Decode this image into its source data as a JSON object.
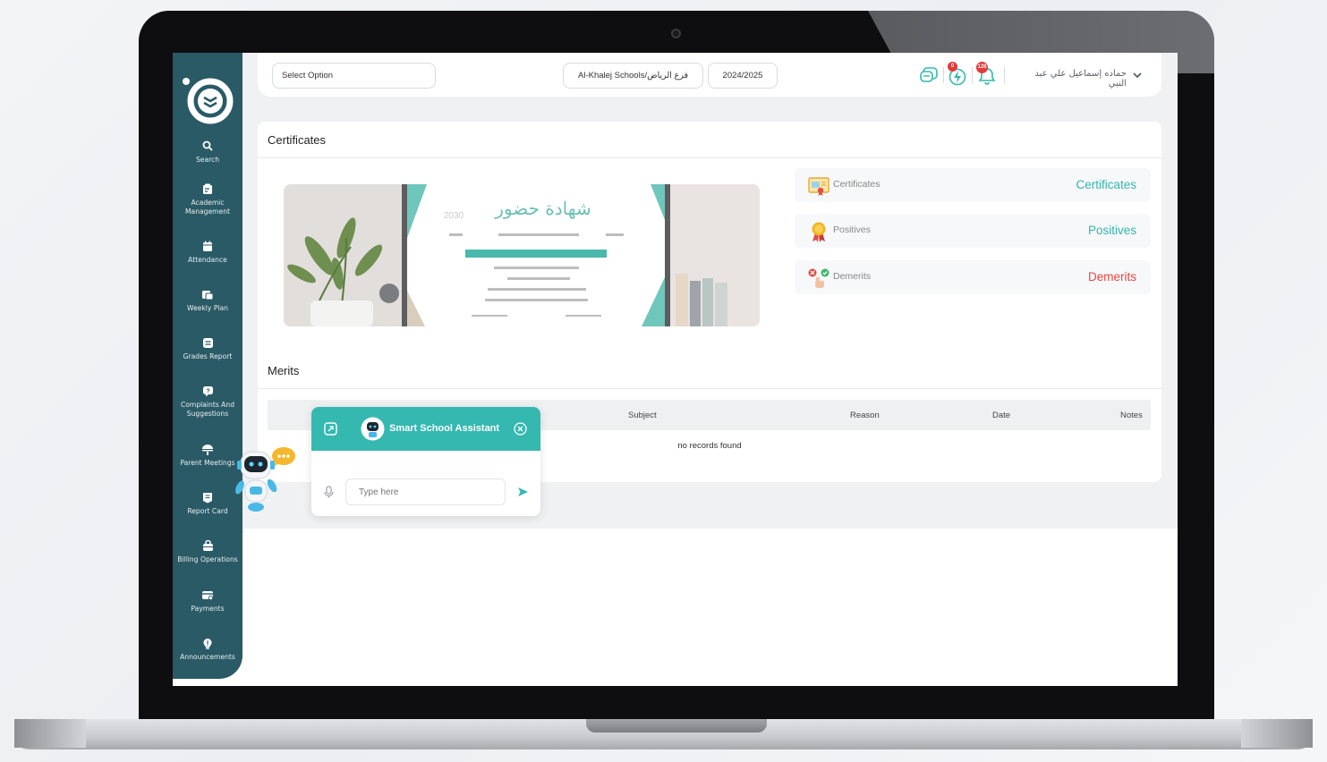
{
  "header": {
    "select_placeholder": "Select Option",
    "school": "Al-Khalej Schools/فرع الرياض",
    "year": "2024/2025",
    "lightning_badge": "0",
    "bell_badge": "128",
    "user_name": "حماده إسماعيل علي عبد النبي"
  },
  "sidebar": {
    "items": [
      {
        "label": "Search",
        "icon": "search-icon"
      },
      {
        "label": "Academic Management",
        "icon": "academic-icon"
      },
      {
        "label": "Attendance",
        "icon": "calendar-icon"
      },
      {
        "label": "Weekly Plan",
        "icon": "weekly-plan-icon"
      },
      {
        "label": "Grades Report",
        "icon": "grades-icon"
      },
      {
        "label": "Complaints And Suggestions",
        "icon": "complaint-icon"
      },
      {
        "label": "Parent Meetings",
        "icon": "meeting-icon"
      },
      {
        "label": "Report Card",
        "icon": "report-card-icon"
      },
      {
        "label": "Billing Operations",
        "icon": "billing-icon"
      },
      {
        "label": "Payments",
        "icon": "payments-icon"
      },
      {
        "label": "Announcements",
        "icon": "announcement-icon"
      }
    ]
  },
  "certificates_card": {
    "title": "Certificates",
    "stats": [
      {
        "label": "Certificates",
        "value": "Certificates",
        "color": "#33b5ad"
      },
      {
        "label": "Positives",
        "value": "Positives",
        "color": "#33b5ad"
      },
      {
        "label": "Demerits",
        "value": "Demerits",
        "color": "#e5473d"
      }
    ]
  },
  "merits_card": {
    "title": "Merits",
    "columns": [
      "Subject",
      "Reason",
      "Date",
      "Notes"
    ],
    "empty_text": "no records found"
  },
  "assistant": {
    "title": "Smart School Assistant",
    "input_placeholder": "Type here"
  },
  "colors": {
    "sidebar": "#2a5a66",
    "accent": "#35b8b0",
    "danger": "#e5473d"
  }
}
